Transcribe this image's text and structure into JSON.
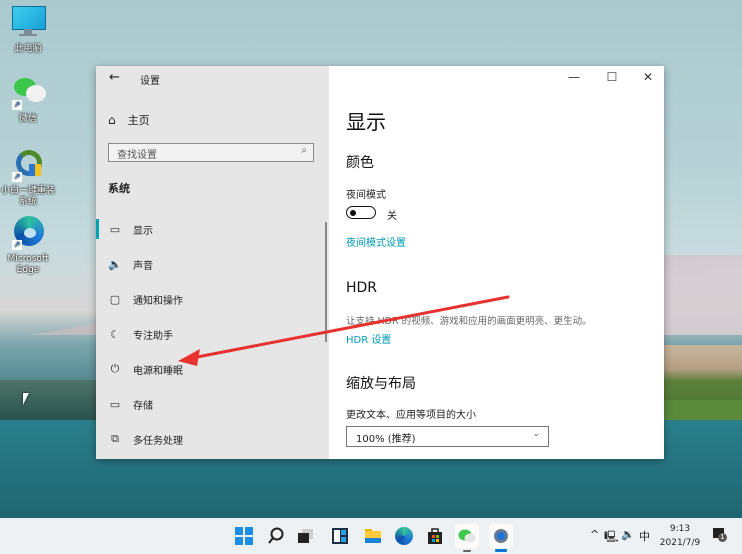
{
  "desktop": {
    "icons": [
      {
        "name": "this-pc",
        "label": "此电脑"
      },
      {
        "name": "wechat",
        "label": "微信"
      },
      {
        "name": "xiaobai",
        "label": "小白一键重装系统"
      },
      {
        "name": "edge",
        "label": "Microsoft Edge"
      }
    ]
  },
  "window": {
    "title": "设置",
    "back_icon": "←",
    "controls": {
      "minimize": "—",
      "maximize": "☐",
      "close": "✕"
    },
    "nav": {
      "home": {
        "icon": "home-icon",
        "label": "主页"
      },
      "search_placeholder": "查找设置",
      "section": "系统",
      "items": [
        {
          "icon": "display-icon",
          "label": "显示",
          "active": true
        },
        {
          "icon": "sound-icon",
          "label": "声音"
        },
        {
          "icon": "notifications-icon",
          "label": "通知和操作"
        },
        {
          "icon": "focus-assist-icon",
          "label": "专注助手"
        },
        {
          "icon": "power-icon",
          "label": "电源和睡眠"
        },
        {
          "icon": "storage-icon",
          "label": "存储"
        },
        {
          "icon": "multitasking-icon",
          "label": "多任务处理"
        }
      ]
    },
    "content": {
      "title": "显示",
      "color": {
        "heading": "颜色",
        "night_light_label": "夜间模式",
        "night_light_state": "关",
        "night_light_on": false,
        "night_light_settings_link": "夜间模式设置"
      },
      "hdr": {
        "heading": "HDR",
        "description": "让支持 HDR 的视频、游戏和应用的画面更明亮、更生动。",
        "settings_link": "HDR 设置"
      },
      "scale": {
        "heading": "缩放与布局",
        "size_label": "更改文本、应用等项目的大小",
        "size_value": "100% (推荐)"
      }
    }
  },
  "taskbar": {
    "apps": [
      "start",
      "search",
      "task-view",
      "widgets",
      "file-explorer",
      "edge",
      "store",
      "wechat",
      "settings"
    ],
    "tray": {
      "chevron": "^",
      "ime": "中",
      "time": "9:13",
      "date": "2021/7/9",
      "notification_count": "1"
    }
  },
  "annotation": {
    "color": "#e8322f"
  }
}
